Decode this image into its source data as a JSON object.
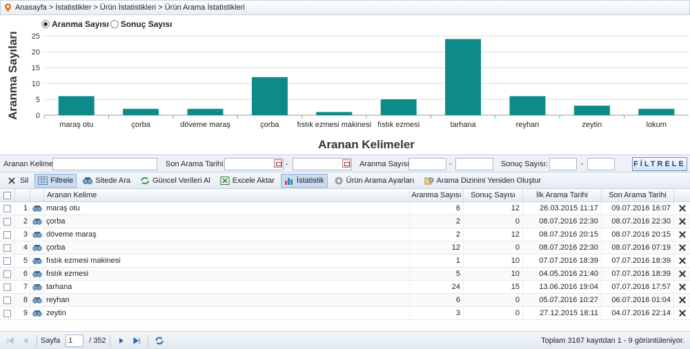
{
  "breadcrumb": {
    "text": "Anasayfa > İstatistikler > Ürün İstatistikleri > Ürün Arama İstatistikleri"
  },
  "radios": {
    "search_count": "Aranma Sayısı",
    "result_count": "Sonuç Sayısı",
    "selected": "search_count"
  },
  "chart_data": {
    "type": "bar",
    "categories": [
      "maraş otu",
      "çorba",
      "döveme maraş",
      "çorba",
      "fıstık ezmesi makinesi",
      "fıstık ezmesi",
      "tarhana",
      "reyhan",
      "zeytin",
      "lokum"
    ],
    "values": [
      6,
      2,
      2,
      12,
      1,
      5,
      24,
      6,
      3,
      2
    ],
    "xlabel": "Aranan Kelimeler",
    "ylabel": "Aranma Sayıları",
    "ylim": [
      0,
      25
    ],
    "yticks": [
      0,
      5,
      10,
      15,
      20,
      25
    ],
    "grid": true,
    "bar_color": "#0f8a8a"
  },
  "filters": {
    "keyword_label": "Aranan Kelime:",
    "date_label": "Son Arama Tarihi:",
    "search_count_label": "Aranma Sayısı:",
    "result_count_label": "Sonuç Sayısı:",
    "dash": "-",
    "filter_button": "FİLTRELE"
  },
  "toolbar": {
    "delete": "Sil",
    "filter": "Filtrele",
    "search_site": "Sitede Ara",
    "update": "Güncel Verileri Al",
    "export": "Excele Aktar",
    "stats": "İstatistik",
    "settings": "Ürün Arama Ayarları",
    "reindex": "Arama Dizinini Yeniden Oluştur"
  },
  "grid": {
    "columns": {
      "keyword": "Aranan Kelime",
      "search_count": "Aranma Sayısı",
      "result_count": "Sonuç Sayısı",
      "first_date": "İlk Arama Tarihi",
      "last_date": "Son Arama Tarihi"
    },
    "rows": [
      {
        "no": "1",
        "keyword": "maraş otu",
        "search": "6",
        "result": "12",
        "first": "26.03.2015 11:17",
        "last": "09.07.2016 16:07"
      },
      {
        "no": "2",
        "keyword": "çorba",
        "search": "2",
        "result": "0",
        "first": "08.07.2016 22:30",
        "last": "08.07.2016 22:30"
      },
      {
        "no": "3",
        "keyword": "döveme maraş",
        "search": "2",
        "result": "12",
        "first": "08.07.2016 20:15",
        "last": "08.07.2016 20:15"
      },
      {
        "no": "4",
        "keyword": "çorba",
        "search": "12",
        "result": "0",
        "first": "08.07.2016 22:30",
        "last": "08.07.2016 07:19"
      },
      {
        "no": "5",
        "keyword": "fıstık ezmesi makinesi",
        "search": "1",
        "result": "10",
        "first": "07.07.2016 18:39",
        "last": "07.07.2016 18:39"
      },
      {
        "no": "6",
        "keyword": "fıstık ezmesi",
        "search": "5",
        "result": "10",
        "first": "04.05.2016 21:40",
        "last": "07.07.2016 18:39"
      },
      {
        "no": "7",
        "keyword": "tarhana",
        "search": "24",
        "result": "15",
        "first": "13.06.2016 19:04",
        "last": "07.07.2016 17:57"
      },
      {
        "no": "8",
        "keyword": "reyhan",
        "search": "6",
        "result": "0",
        "first": "05.07.2016 10:27",
        "last": "06.07.2016 01:04"
      },
      {
        "no": "9",
        "keyword": "zeytin",
        "search": "3",
        "result": "0",
        "first": "27.12.2015 18:11",
        "last": "04.07.2016 22:14"
      }
    ]
  },
  "pager": {
    "page_label": "Sayfa",
    "page_value": "1",
    "total_pages": "/ 352",
    "info": "Toplam 3167 kayıtdan 1 - 9 görüntüleniyor."
  }
}
